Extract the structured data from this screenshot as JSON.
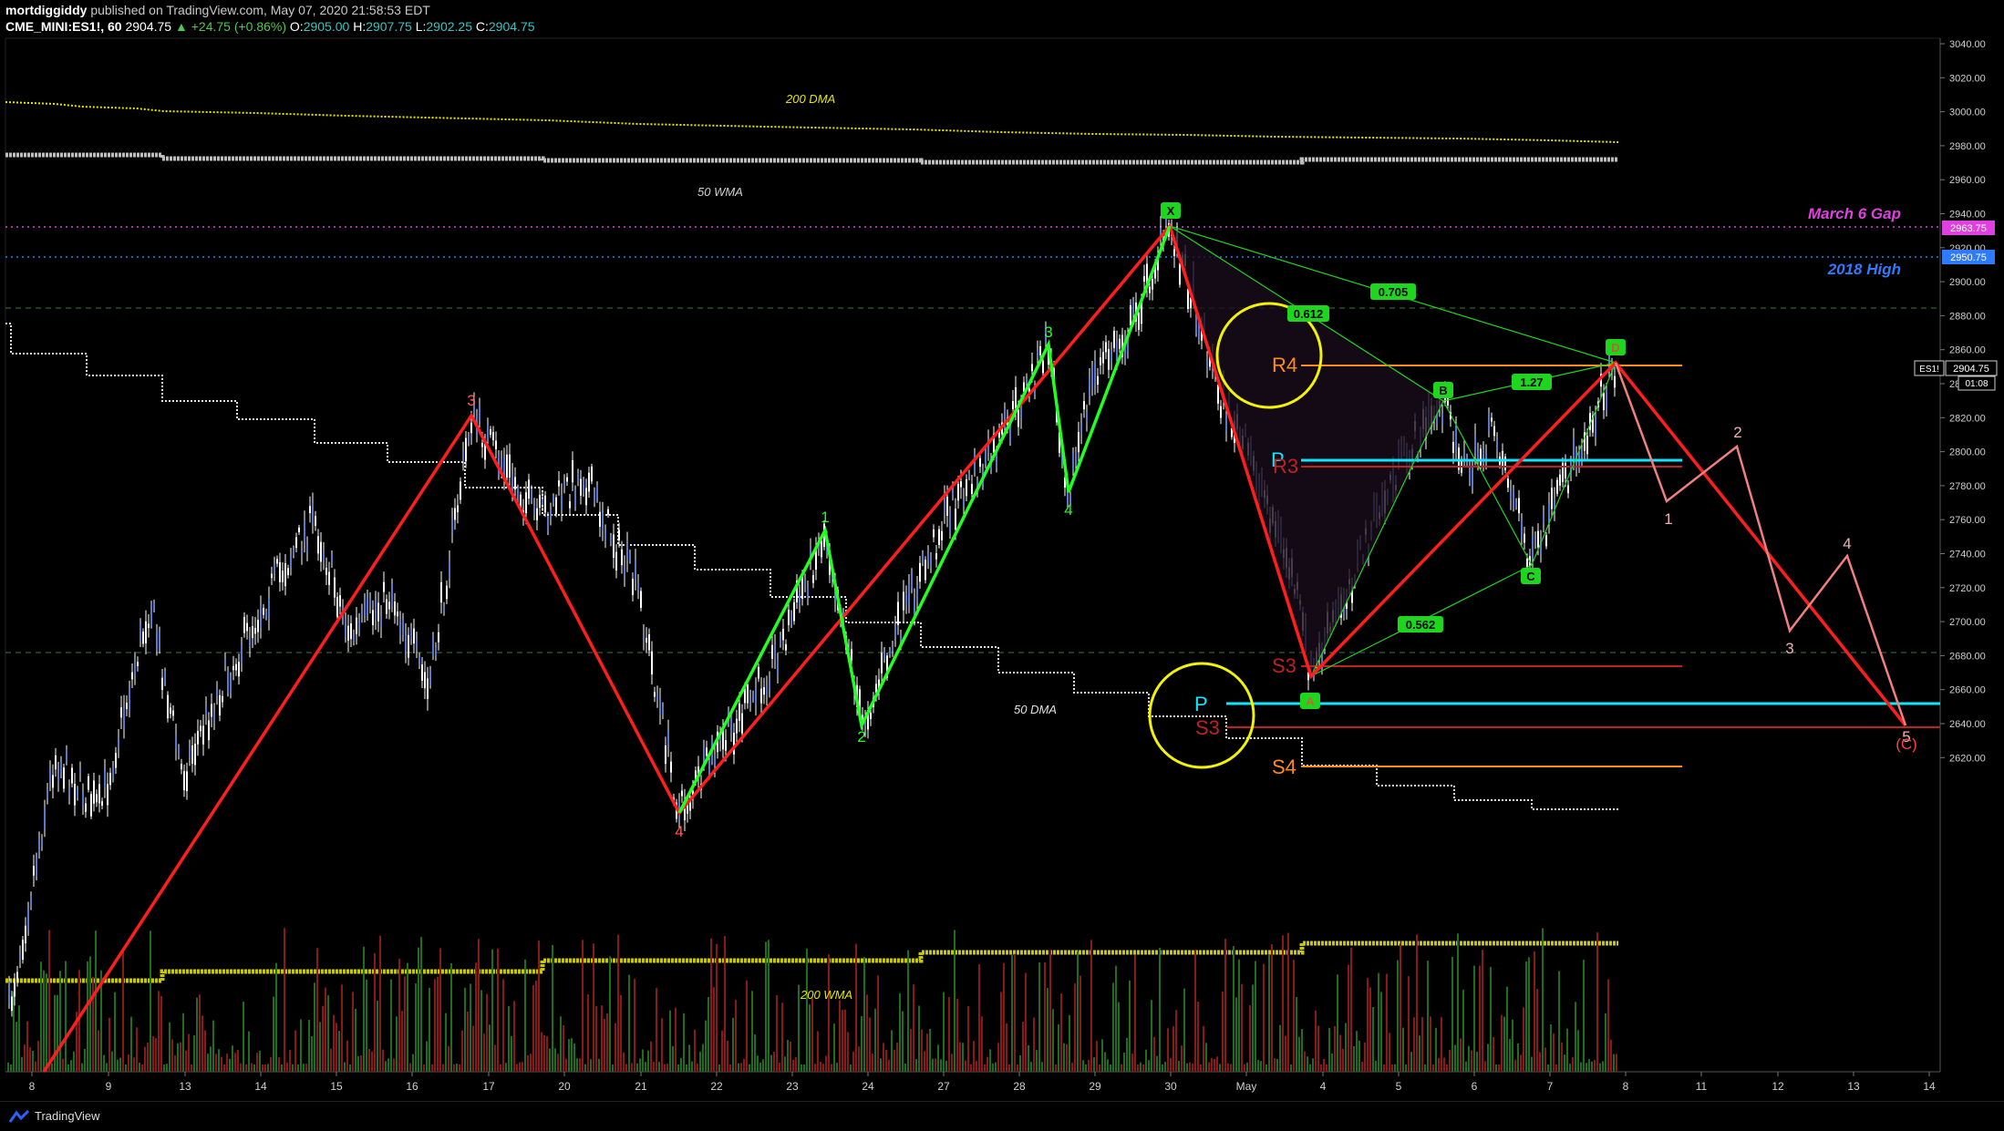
{
  "header": {
    "author": "mortdiggiddy",
    "published": "published on TradingView.com, May 07, 2020 21:58:53 EDT",
    "symbol": "CME_MINI:ES1!, 60",
    "last": "2904.75",
    "change": "▲ +24.75 (+0.86%)",
    "open_label": "O:",
    "open": "2905.00",
    "high_label": "H:",
    "high": "2907.75",
    "low_label": "L:",
    "low": "2902.25",
    "close_label": "C:",
    "close": "2904.75"
  },
  "footer": {
    "brand": "TradingView",
    "icon": "tradingview-logo-icon"
  },
  "colors": {
    "background": "#000000",
    "candle": "#ffffff",
    "pivot_red": "#ff1e1e",
    "wave_green": "#22ff22",
    "march_gap": "#e040e0",
    "high_2018": "#2f7bff",
    "dma200": "#e6e600",
    "wma": "#bdbdbd",
    "pivot_cyan": "#12e6ff",
    "r4_orange": "#ff8c1a",
    "circle_yellow": "#f3f300",
    "harmonic_badge": "#1fd61f"
  },
  "price_axis": {
    "ticks": [
      "3040.00",
      "3020.00",
      "3000.00",
      "2980.00",
      "2960.00",
      "2940.00",
      "2920.00",
      "2900.00",
      "2880.00",
      "2860.00",
      "2840.00",
      "2820.00",
      "2800.00",
      "2780.00",
      "2760.00",
      "2740.00",
      "2720.00",
      "2700.00",
      "2680.00",
      "2660.00",
      "2640.00",
      "2620.00"
    ],
    "labels": {
      "march_gap": "2963.75",
      "high_2018": "2950.75",
      "symbol_tag": "ES1!",
      "current": "2904.75",
      "countdown": "01:08"
    }
  },
  "time_axis": {
    "ticks": [
      "8",
      "9",
      "13",
      "14",
      "15",
      "16",
      "17",
      "20",
      "21",
      "22",
      "23",
      "24",
      "27",
      "28",
      "29",
      "30",
      "May",
      "4",
      "5",
      "6",
      "7",
      "8",
      "11",
      "12",
      "13",
      "14"
    ]
  },
  "annotations": {
    "dma200_top": "200 DMA",
    "wma50": "50 WMA",
    "dma50": "50 DMA",
    "wma200": "200 WMA",
    "march_gap": "March 6 Gap",
    "high_2018": "2018 High",
    "pivots": {
      "r4": "R4",
      "r3": "R3",
      "p_top": "P",
      "s3_top": "S3",
      "p_bottom": "P",
      "s3_bottom": "S3",
      "s4": "S4"
    },
    "harmonic": {
      "x": "X",
      "a": "A",
      "b": "B",
      "c": "C",
      "d": "D",
      "r1": "0.612",
      "r2": "0.705",
      "r3": "1.27",
      "r4": "0.562"
    },
    "waves_red": {
      "w3_left": "3",
      "w4_left": "4",
      "w4_right": "4"
    },
    "waves_green": {
      "g1": "1",
      "g2": "2",
      "g3": "3",
      "g4": "4"
    },
    "projection": {
      "p1": "1",
      "p2": "2",
      "p3": "3",
      "p4": "4",
      "p5": "5",
      "pc": "(C)"
    }
  }
}
